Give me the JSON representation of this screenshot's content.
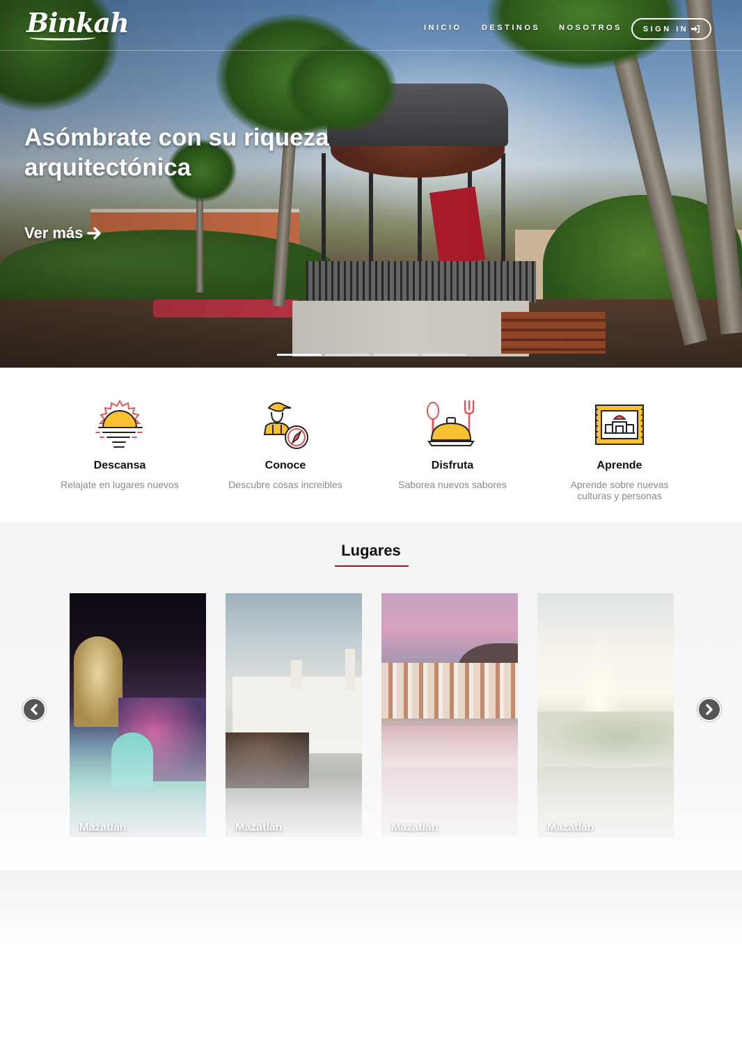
{
  "nav": {
    "logo_text": "Binkah",
    "links": [
      "INICIO",
      "DESTINOS",
      "NOSOTROS"
    ],
    "signin_label": "SIGN IN",
    "signin_icon": "sign-in-icon"
  },
  "hero": {
    "title": "Asómbrate con su riqueza arquitectónica",
    "cta_label": "Ver más",
    "cta_icon": "arrow-right-icon",
    "slides_total": 4,
    "active_slide": 1
  },
  "features": [
    {
      "icon": "sunset-icon",
      "title": "Descansa",
      "desc": "Relajate en lugares nuevos"
    },
    {
      "icon": "explorer-compass-icon",
      "title": "Conoce",
      "desc": "Descubre cosas increibles"
    },
    {
      "icon": "dish-cutlery-icon",
      "title": "Disfruta",
      "desc": "Saborea nuevos sabores"
    },
    {
      "icon": "stamp-icon",
      "title": "Aprende",
      "desc": "Aprende sobre nuevas culturas y personas"
    }
  ],
  "lugares": {
    "title": "Lugares",
    "cards": [
      {
        "label": "Mazatlán",
        "image": "carnival-parade-night"
      },
      {
        "label": "Mazatlán",
        "image": "church-on-coast"
      },
      {
        "label": "Mazatlán",
        "image": "bay-at-sunset"
      },
      {
        "label": "Mazatlán",
        "image": "malecon-aerial"
      }
    ],
    "prev_icon": "chevron-left-icon",
    "next_icon": "chevron-right-icon"
  },
  "colors": {
    "accent": "#8a1b24",
    "icon_yellow": "#f7c132",
    "icon_red": "#e05555",
    "text_muted": "#8a8a8a"
  }
}
